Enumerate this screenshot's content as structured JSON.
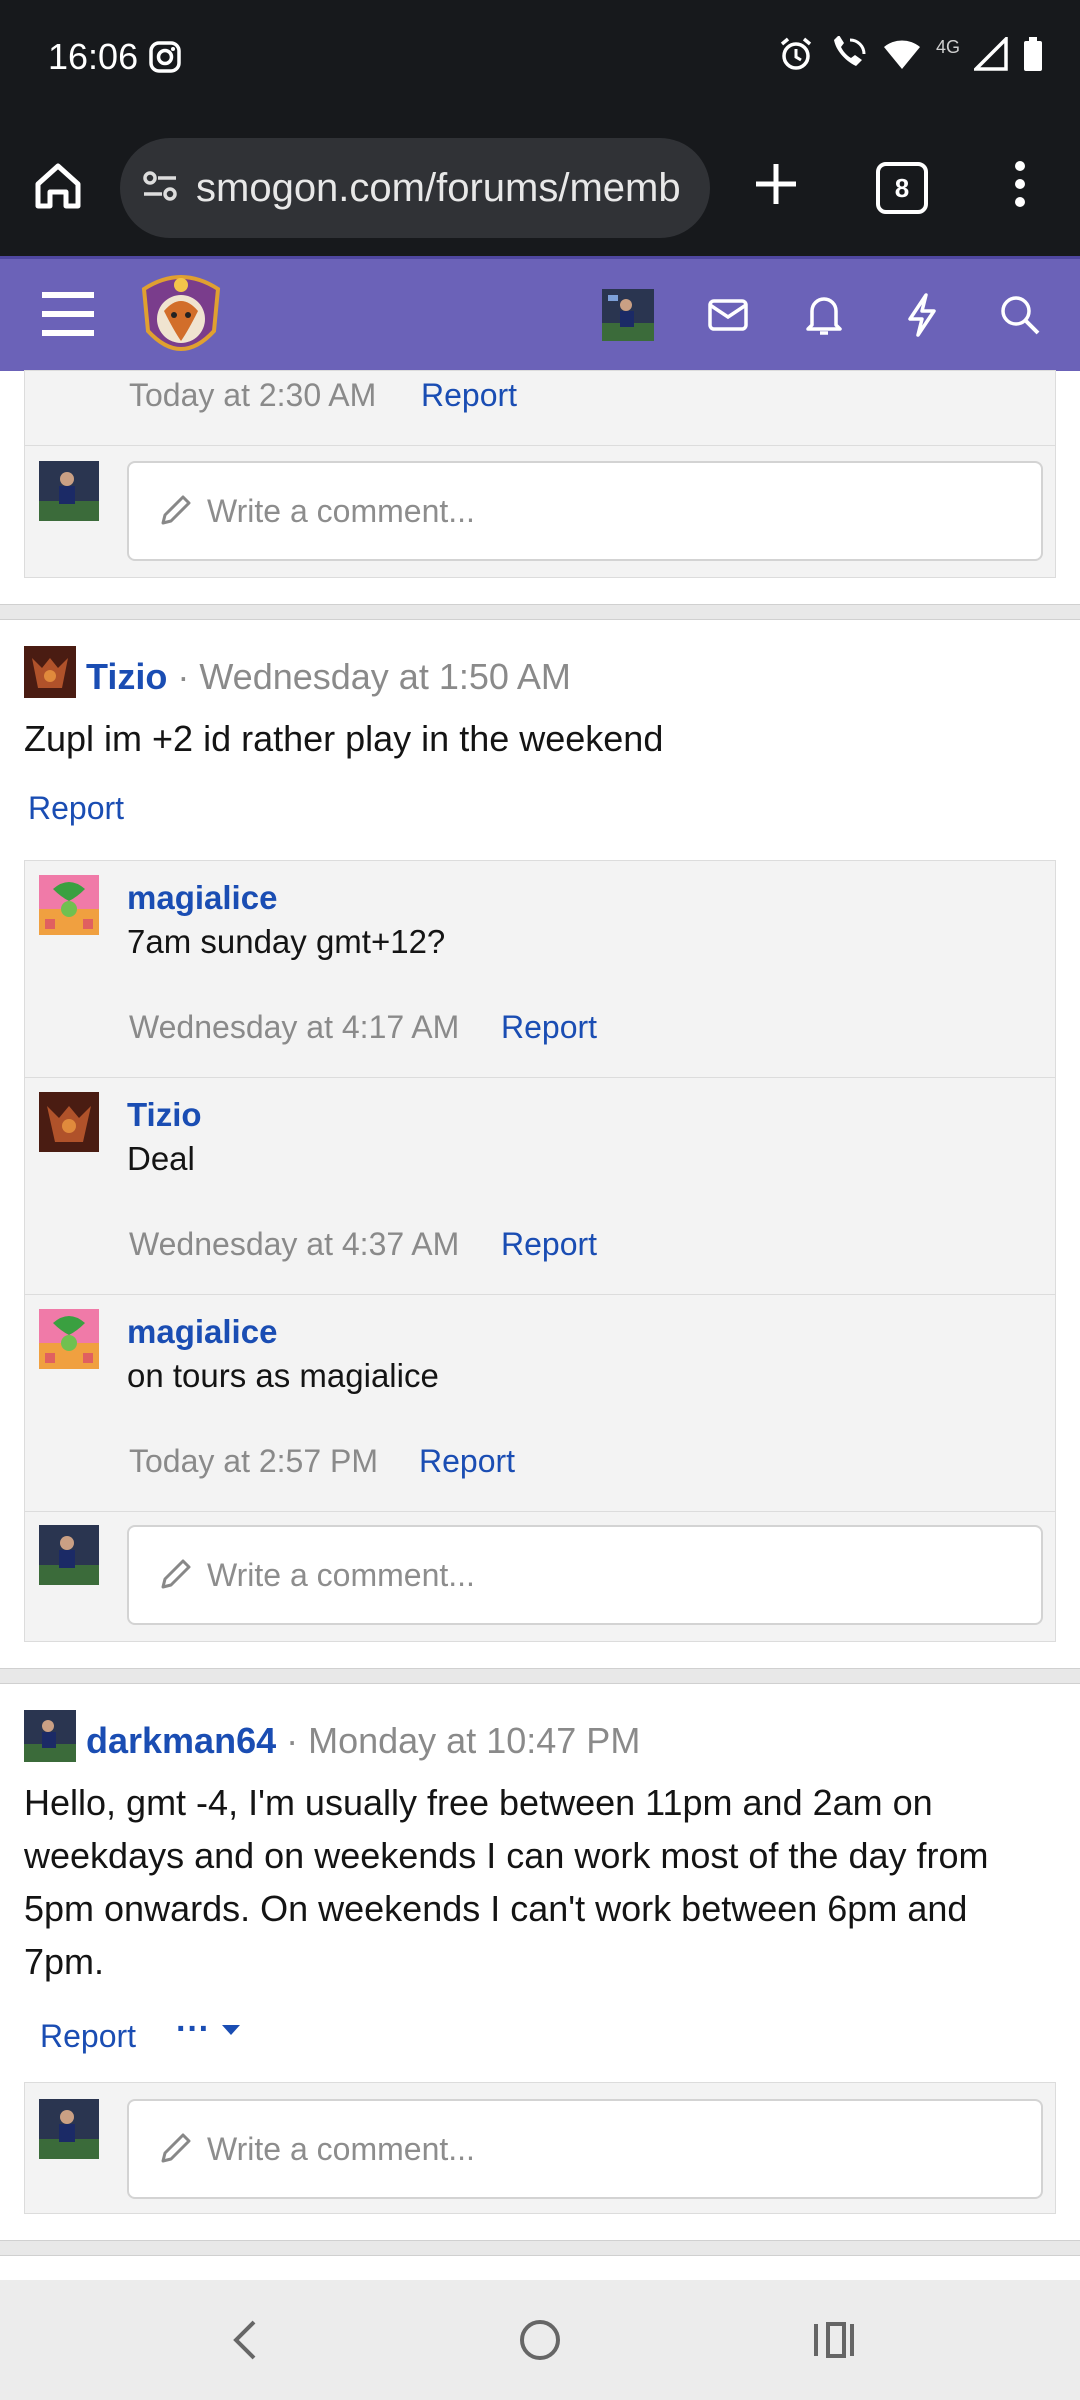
{
  "status_bar": {
    "time": "16:06",
    "network": "4G"
  },
  "browser": {
    "url": "smogon.com/forums/memb",
    "tab_count": "8"
  },
  "colors": {
    "site_bar": "#6b62b8",
    "link": "#1a4db3",
    "meta": "#8a8a8a"
  },
  "thread_top": {
    "timestamp": "Today at 2:30 AM",
    "report": "Report",
    "write_placeholder": "Write a comment..."
  },
  "posts": [
    {
      "author": "Tizio",
      "separator": "·",
      "date": "Wednesday at 1:50 AM",
      "body": "Zupl im +2 id rather play in the weekend",
      "report": "Report",
      "comments": [
        {
          "author": "magialice",
          "text": "7am sunday gmt+12?",
          "time": "Wednesday at 4:17 AM",
          "report": "Report"
        },
        {
          "author": "Tizio",
          "text": "Deal",
          "time": "Wednesday at 4:37 AM",
          "report": "Report"
        },
        {
          "author": "magialice",
          "text": "on tours as magialice",
          "time": "Today at 2:57 PM",
          "report": "Report"
        }
      ],
      "write_placeholder": "Write a comment..."
    },
    {
      "author": "darkman64",
      "separator": "·",
      "date": "Monday at 10:47 PM",
      "body": "Hello, gmt -4, I'm usually free between 11pm and 2am on weekdays and on weekends I can work most of the day from 5pm onwards. On weekends I can't work between 6pm and 7pm.",
      "report": "Report",
      "more": "···",
      "write_placeholder": "Write a comment..."
    }
  ]
}
